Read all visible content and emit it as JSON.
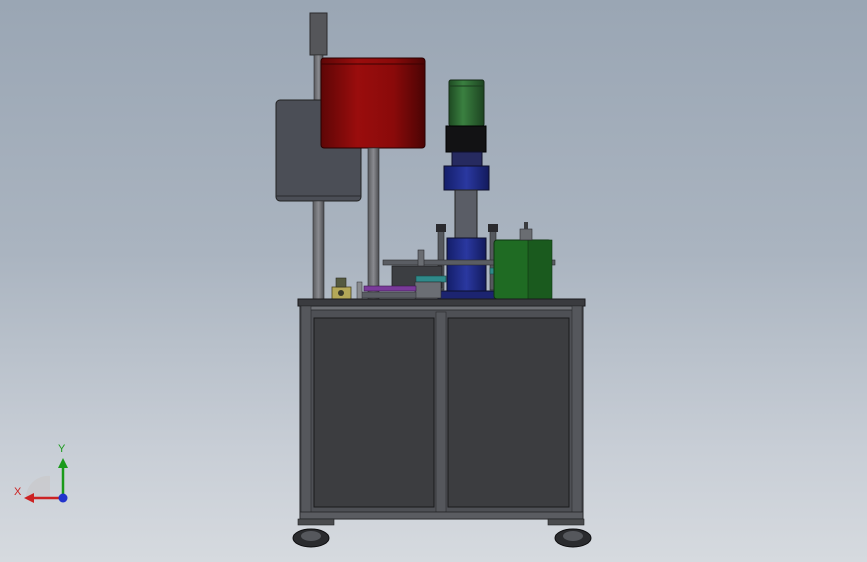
{
  "view": {
    "background_top": "#9aa6b4",
    "background_bottom": "#d6dadf"
  },
  "model": {
    "cabinet_color": "#3c3d40",
    "frame_color": "#6e7075",
    "red_housing_color": "#8e0a0a",
    "green_motor_color": "#2f6e34",
    "blue_press_color": "#1e2a8a",
    "dark_box_color": "#4a4d55",
    "green_block_color": "#1f6b23",
    "purple_rail_color": "#7a3a9a",
    "teal_plate_color": "#2f8a8a"
  },
  "triad": {
    "x_label": "X",
    "y_label": "Y",
    "x_color": "#cc2222",
    "y_color": "#1a9a1a",
    "z_color": "#2233cc"
  }
}
